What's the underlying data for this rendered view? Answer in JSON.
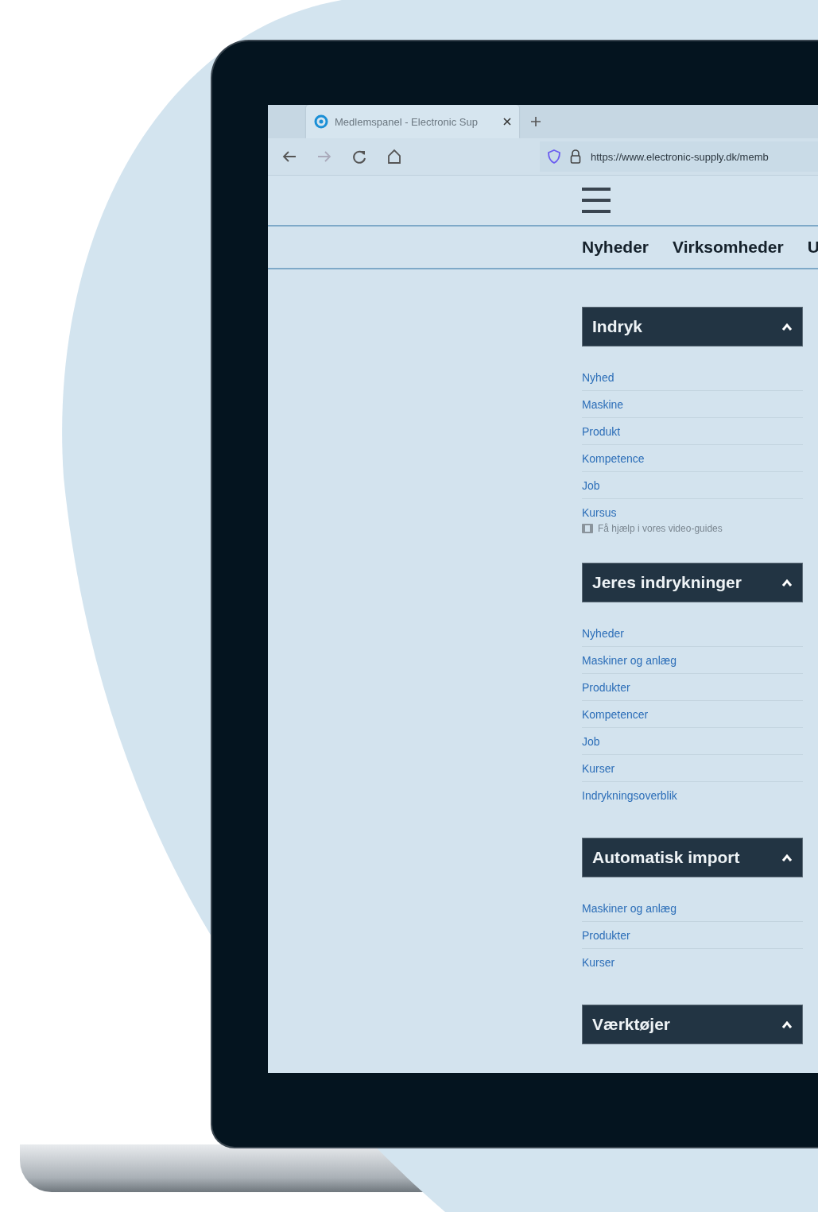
{
  "browser": {
    "tab": {
      "title": "Medlemspanel - Electronic Sup",
      "selected": true
    },
    "url": "https://www.electronic-supply.dk/memb"
  },
  "nav": [
    "Nyheder",
    "Virksomheder",
    "U"
  ],
  "sections": [
    {
      "title": "Indryk",
      "expanded": true,
      "items": [
        "Nyhed",
        "Maskine",
        "Produkt",
        "Kompetence",
        "Job",
        "Kursus"
      ],
      "help": "Få hjælp i vores video-guides"
    },
    {
      "title": "Jeres indrykninger",
      "expanded": true,
      "items": [
        "Nyheder",
        "Maskiner og anlæg",
        "Produkter",
        "Kompetencer",
        "Job",
        "Kurser",
        "Indrykningsoverblik"
      ]
    },
    {
      "title": "Automatisk import",
      "expanded": true,
      "items": [
        "Maskiner og anlæg",
        "Produkter",
        "Kurser"
      ]
    },
    {
      "title": "Værktøjer",
      "expanded": true
    }
  ]
}
